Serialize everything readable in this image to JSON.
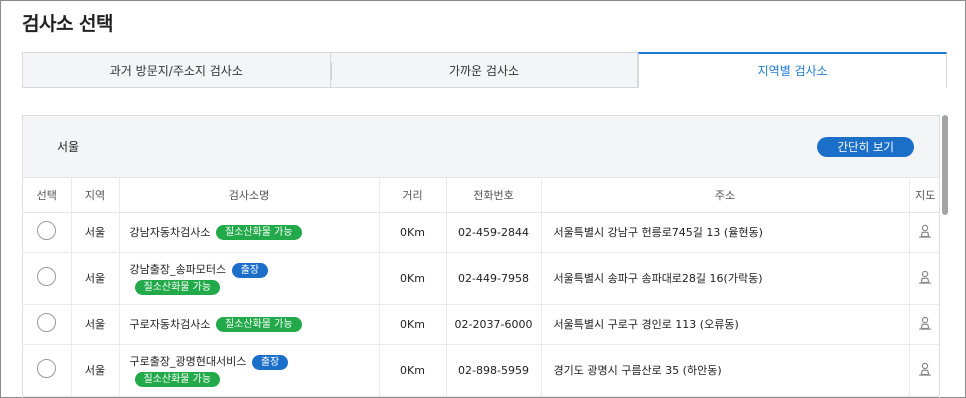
{
  "page": {
    "title": "검사소 선택"
  },
  "tabs": [
    {
      "label": "과거 방문지/주소지 검사소",
      "active": false
    },
    {
      "label": "가까운 검사소",
      "active": false
    },
    {
      "label": "지역별 검사소",
      "active": true
    }
  ],
  "region_bar": {
    "region": "서울",
    "simple_view_label": "간단히 보기"
  },
  "table": {
    "columns": [
      "선택",
      "지역",
      "검사소명",
      "거리",
      "전화번호",
      "주소",
      "지도"
    ],
    "rows": [
      {
        "region": "서울",
        "name": "강남자동차검사소",
        "badges": [
          {
            "label": "질소산화물 가능",
            "color": "green"
          }
        ],
        "distance": "0Km",
        "phone": "02-459-2844",
        "address": "서울특별시 강남구 헌릉로745길 13 (율현동)"
      },
      {
        "region": "서울",
        "name": "강남출장_송파모터스",
        "badges": [
          {
            "label": "출장",
            "color": "blue"
          },
          {
            "label": "질소산화물 가능",
            "color": "green"
          }
        ],
        "distance": "0Km",
        "phone": "02-449-7958",
        "address": "서울특별시 송파구 송파대로28길 16(가락동)"
      },
      {
        "region": "서울",
        "name": "구로자동차검사소",
        "badges": [
          {
            "label": "질소산화물 가능",
            "color": "green"
          }
        ],
        "distance": "0Km",
        "phone": "02-2037-6000",
        "address": "서울특별시 구로구 경인로 113 (오류동)"
      },
      {
        "region": "서울",
        "name": "구로출장_광명현대서비스",
        "badges": [
          {
            "label": "출장",
            "color": "blue"
          },
          {
            "label": "질소산화물 가능",
            "color": "green"
          }
        ],
        "distance": "0Km",
        "phone": "02-898-5959",
        "address": "경기도 광명시 구름산로 35 (하안동)"
      }
    ]
  },
  "icons": {
    "radio": "radio-unchecked-icon",
    "map": "map-marker-person-icon"
  },
  "colors": {
    "accent": "#1c7ad4",
    "button": "#1c6fc9",
    "badge_green": "#22a94a",
    "badge_blue": "#1c6fc9",
    "tab_bg": "#f4f5f7"
  }
}
